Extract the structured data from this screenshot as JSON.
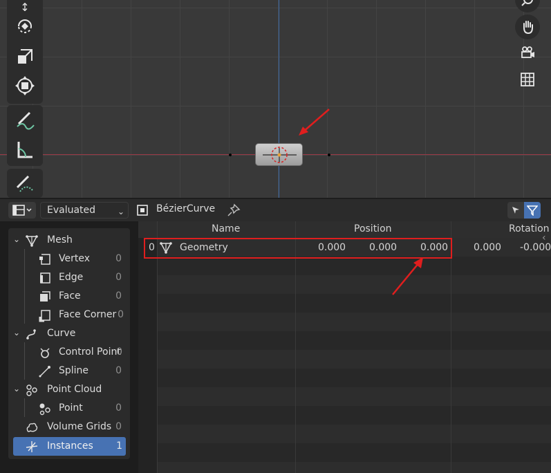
{
  "header": {
    "evaluation_mode": "Evaluated",
    "object_name": "BézierCurve"
  },
  "domains": [
    {
      "label": "Mesh",
      "count": "",
      "level": 0,
      "icon": "mesh-icon"
    },
    {
      "label": "Vertex",
      "count": "0",
      "level": 1,
      "icon": "vertex-icon"
    },
    {
      "label": "Edge",
      "count": "0",
      "level": 1,
      "icon": "edge-icon"
    },
    {
      "label": "Face",
      "count": "0",
      "level": 1,
      "icon": "face-icon"
    },
    {
      "label": "Face Corner",
      "count": "0",
      "level": 1,
      "icon": "face-corner-icon"
    },
    {
      "label": "Curve",
      "count": "",
      "level": 0,
      "icon": "curve-icon"
    },
    {
      "label": "Control Point",
      "count": "0",
      "level": 1,
      "icon": "control-point-icon"
    },
    {
      "label": "Spline",
      "count": "0",
      "level": 1,
      "icon": "spline-icon"
    },
    {
      "label": "Point Cloud",
      "count": "",
      "level": 0,
      "icon": "point-cloud-icon"
    },
    {
      "label": "Point",
      "count": "0",
      "level": 1,
      "icon": "point-icon"
    },
    {
      "label": "Volume Grids",
      "count": "0",
      "level": 0,
      "icon": "volume-icon"
    },
    {
      "label": "Instances",
      "count": "1",
      "level": 0,
      "icon": "instances-icon",
      "active": true
    }
  ],
  "table": {
    "columns": [
      "Name",
      "Position",
      "Rotation"
    ],
    "rows": [
      {
        "index": "0",
        "name": "Geometry",
        "position": [
          "0.000",
          "0.000",
          "0.000"
        ],
        "rotation": [
          "0.000",
          "-0.000"
        ]
      }
    ]
  },
  "colors": {
    "accent": "#4772b3",
    "annotation": "#e01e1e",
    "x_axis": "#9b3a46",
    "y_axis": "#3d6ba8"
  }
}
